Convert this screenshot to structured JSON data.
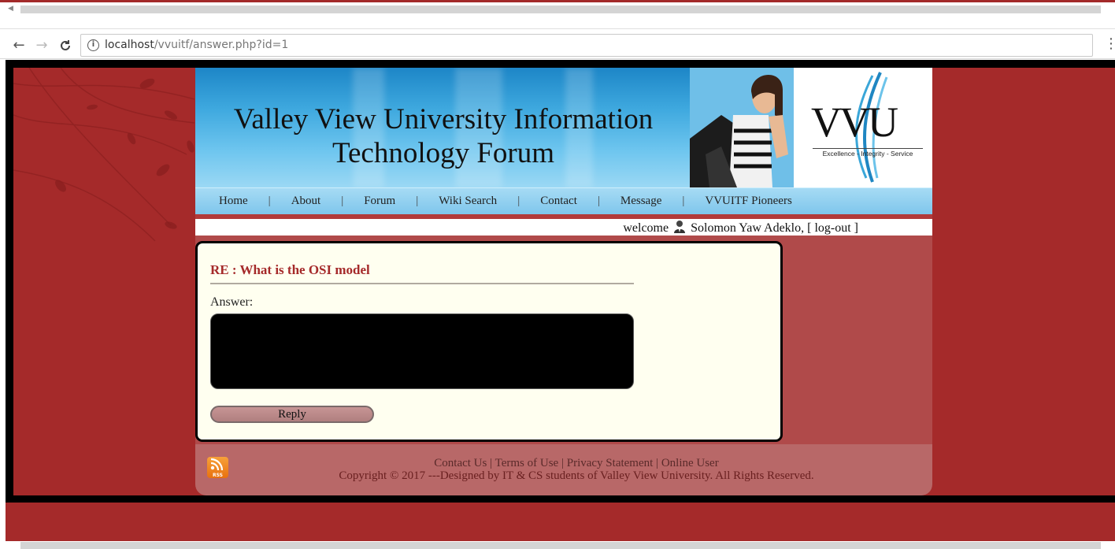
{
  "browser": {
    "url_host": "localhost",
    "url_path": "/vvuitf/answer.php?id=1",
    "back_icon": "←",
    "forward_icon": "→",
    "reload_icon": "C",
    "info_icon": "i",
    "star_icon": "☆",
    "menu_icon": "⋮"
  },
  "site": {
    "title_line1": "Valley View University Information",
    "title_line2": "Technology Forum",
    "logo_text": "VVU",
    "logo_tagline": "Excellence - Integrity - Service"
  },
  "nav": {
    "items": [
      "Home",
      "About",
      "Forum",
      "Wiki Search",
      "Contact",
      "Message",
      "VVUITF Pioneers"
    ],
    "separator": "|"
  },
  "welcome": {
    "prefix": "welcome",
    "user_name": "Solomon Yaw Adeklo,",
    "logout": "[ log-out ]"
  },
  "answer": {
    "title": "RE : What is the OSI model",
    "label": "Answer:",
    "textarea_value": "",
    "reply_label": "Reply"
  },
  "footer": {
    "links": [
      "Contact Us",
      "Terms of Use",
      "Privacy Statement",
      "Online User"
    ],
    "separator": "|",
    "copyright": "Copyright © 2017 ---Designed by IT & CS students of Valley View University. All Rights Reserved.",
    "rss_label": "RSS"
  },
  "colors": {
    "page_bg": "#a52a2a",
    "accent_title": "#a52a2a",
    "nav_bg": "#8fd0ee",
    "answer_box_bg": "#fffff0"
  }
}
